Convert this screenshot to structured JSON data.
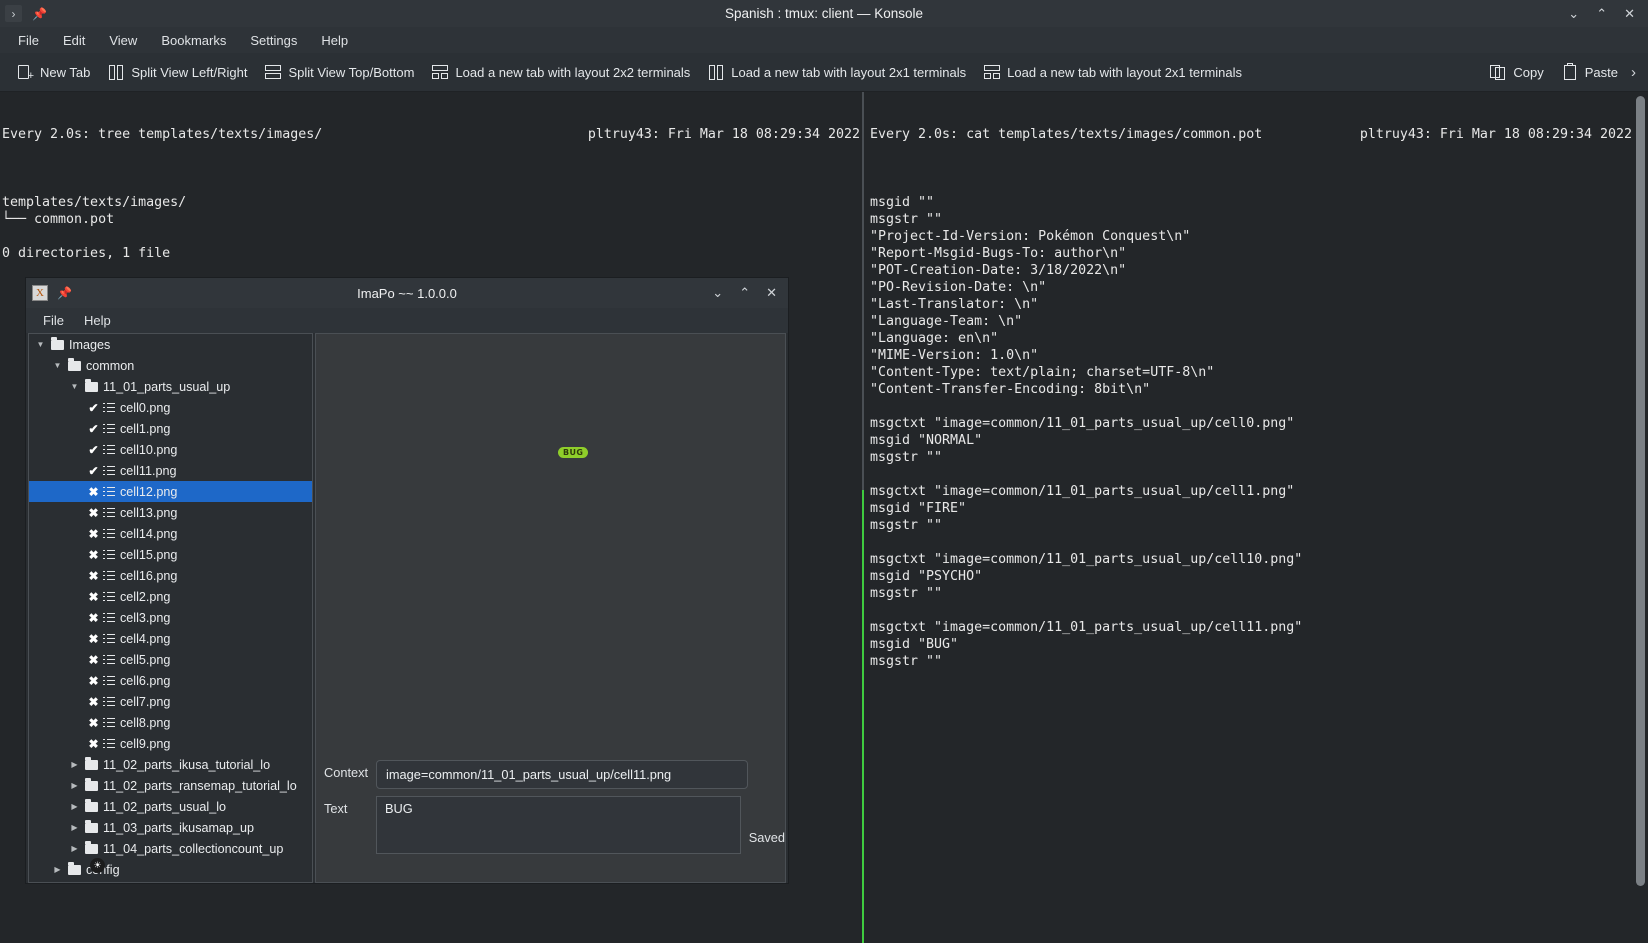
{
  "window": {
    "title": "Spanish : tmux: client — Konsole",
    "controls": [
      "⌄",
      "⌃",
      "✕"
    ],
    "menu_button": "›",
    "pin_icon": "pin-icon"
  },
  "menubar": [
    "File",
    "Edit",
    "View",
    "Bookmarks",
    "Settings",
    "Help"
  ],
  "toolbar": {
    "items": [
      {
        "label": "New Tab",
        "icon": "new-tab-icon"
      },
      {
        "label": "Split View Left/Right",
        "icon": "split-left-right-icon"
      },
      {
        "label": "Split View Top/Bottom",
        "icon": "split-top-bottom-icon"
      },
      {
        "label": "Load a new tab with layout 2x2 terminals",
        "icon": "layout-2x2-icon"
      },
      {
        "label": "Load a new tab with layout 2x1 terminals",
        "icon": "layout-2x1-icon"
      },
      {
        "label": "Load a new tab with layout 2x1 terminals",
        "icon": "layout-2x1-icon"
      }
    ],
    "copy_label": "Copy",
    "paste_label": "Paste",
    "overflow": "›"
  },
  "terminal": {
    "left_pane": {
      "watch_command": "Every 2.0s: tree templates/texts/images/",
      "watch_host_time": "pltruy43: Fri Mar 18 08:29:34 2022",
      "lines": [
        "templates/texts/images/",
        "└── common.pot",
        "",
        "0 directories, 1 file"
      ]
    },
    "right_pane": {
      "watch_command": "Every 2.0s: cat templates/texts/images/common.pot",
      "watch_host_time": "pltruy43: Fri Mar 18 08:29:34 2022",
      "lines": [
        "msgid \"\"",
        "msgstr \"\"",
        "\"Project-Id-Version: Pokémon Conquest\\n\"",
        "\"Report-Msgid-Bugs-To: author\\n\"",
        "\"POT-Creation-Date: 3/18/2022\\n\"",
        "\"PO-Revision-Date: \\n\"",
        "\"Last-Translator: \\n\"",
        "\"Language-Team: \\n\"",
        "\"Language: en\\n\"",
        "\"MIME-Version: 1.0\\n\"",
        "\"Content-Type: text/plain; charset=UTF-8\\n\"",
        "\"Content-Transfer-Encoding: 8bit\\n\"",
        "",
        "msgctxt \"image=common/11_01_parts_usual_up/cell0.png\"",
        "msgid \"NORMAL\"",
        "msgstr \"\"",
        "",
        "msgctxt \"image=common/11_01_parts_usual_up/cell1.png\"",
        "msgid \"FIRE\"",
        "msgstr \"\"",
        "",
        "msgctxt \"image=common/11_01_parts_usual_up/cell10.png\"",
        "msgid \"PSYCHO\"",
        "msgstr \"\"",
        "",
        "msgctxt \"image=common/11_01_parts_usual_up/cell11.png\"",
        "msgid \"BUG\"",
        "msgstr \"\""
      ]
    }
  },
  "imapo": {
    "title": "ImaPo ~~ 1.0.0.0",
    "controls": [
      "⌄",
      "⌃",
      "✕"
    ],
    "menu": [
      "File",
      "Help"
    ],
    "tree": [
      {
        "label": "Images",
        "indent": 0,
        "type": "folder",
        "arrow": "down"
      },
      {
        "label": "common",
        "indent": 1,
        "type": "folder",
        "arrow": "down"
      },
      {
        "label": "11_01_parts_usual_up",
        "indent": 2,
        "type": "folder",
        "arrow": "down"
      },
      {
        "label": "cell0.png",
        "indent": 3,
        "type": "file",
        "mark": "✔",
        "selected": false
      },
      {
        "label": "cell1.png",
        "indent": 3,
        "type": "file",
        "mark": "✔",
        "selected": false
      },
      {
        "label": "cell10.png",
        "indent": 3,
        "type": "file",
        "mark": "✔",
        "selected": false
      },
      {
        "label": "cell11.png",
        "indent": 3,
        "type": "file",
        "mark": "✔",
        "selected": false
      },
      {
        "label": "cell12.png",
        "indent": 3,
        "type": "file",
        "mark": "✖",
        "selected": true
      },
      {
        "label": "cell13.png",
        "indent": 3,
        "type": "file",
        "mark": "✖",
        "selected": false
      },
      {
        "label": "cell14.png",
        "indent": 3,
        "type": "file",
        "mark": "✖",
        "selected": false
      },
      {
        "label": "cell15.png",
        "indent": 3,
        "type": "file",
        "mark": "✖",
        "selected": false
      },
      {
        "label": "cell16.png",
        "indent": 3,
        "type": "file",
        "mark": "✖",
        "selected": false
      },
      {
        "label": "cell2.png",
        "indent": 3,
        "type": "file",
        "mark": "✖",
        "selected": false
      },
      {
        "label": "cell3.png",
        "indent": 3,
        "type": "file",
        "mark": "✖",
        "selected": false
      },
      {
        "label": "cell4.png",
        "indent": 3,
        "type": "file",
        "mark": "✖",
        "selected": false
      },
      {
        "label": "cell5.png",
        "indent": 3,
        "type": "file",
        "mark": "✖",
        "selected": false
      },
      {
        "label": "cell6.png",
        "indent": 3,
        "type": "file",
        "mark": "✖",
        "selected": false
      },
      {
        "label": "cell7.png",
        "indent": 3,
        "type": "file",
        "mark": "✖",
        "selected": false
      },
      {
        "label": "cell8.png",
        "indent": 3,
        "type": "file",
        "mark": "✖",
        "selected": false
      },
      {
        "label": "cell9.png",
        "indent": 3,
        "type": "file",
        "mark": "✖",
        "selected": false
      },
      {
        "label": "11_02_parts_ikusa_tutorial_lo",
        "indent": 2,
        "type": "folder",
        "arrow": "right"
      },
      {
        "label": "11_02_parts_ransemap_tutorial_lo",
        "indent": 2,
        "type": "folder",
        "arrow": "right"
      },
      {
        "label": "11_02_parts_usual_lo",
        "indent": 2,
        "type": "folder",
        "arrow": "right"
      },
      {
        "label": "11_03_parts_ikusamap_up",
        "indent": 2,
        "type": "folder",
        "arrow": "right"
      },
      {
        "label": "11_04_parts_collectioncount_up",
        "indent": 2,
        "type": "folder",
        "arrow": "right"
      },
      {
        "label": "config",
        "indent": 1,
        "type": "folder",
        "arrow": "right"
      }
    ],
    "preview": {
      "badge_text": "BUG",
      "badge_color": "#8fce2a"
    },
    "form": {
      "context_label": "Context",
      "context_value": "image=common/11_01_parts_usual_up/cell11.png",
      "text_label": "Text",
      "text_value": "BUG",
      "status": "Saved"
    }
  }
}
